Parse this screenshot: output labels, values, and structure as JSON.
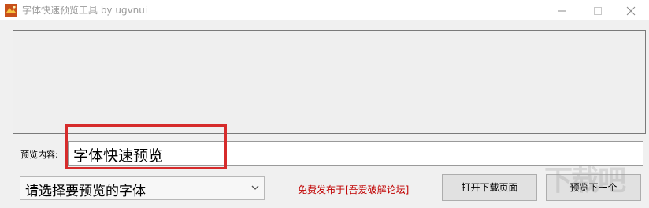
{
  "window": {
    "title": "字体快速预览工具 by ugvnui"
  },
  "preview": {
    "label": "预览内容:",
    "text": "字体快速预览"
  },
  "font_select": {
    "value": "请选择要预览的字体"
  },
  "notice": "免费发布于[吾爱破解论坛]",
  "buttons": {
    "open_download": "打开下载页面",
    "next": "预览下一个"
  },
  "watermark": "下载吧",
  "colors": {
    "highlight": "#d62b2b",
    "notice": "#c00000"
  }
}
